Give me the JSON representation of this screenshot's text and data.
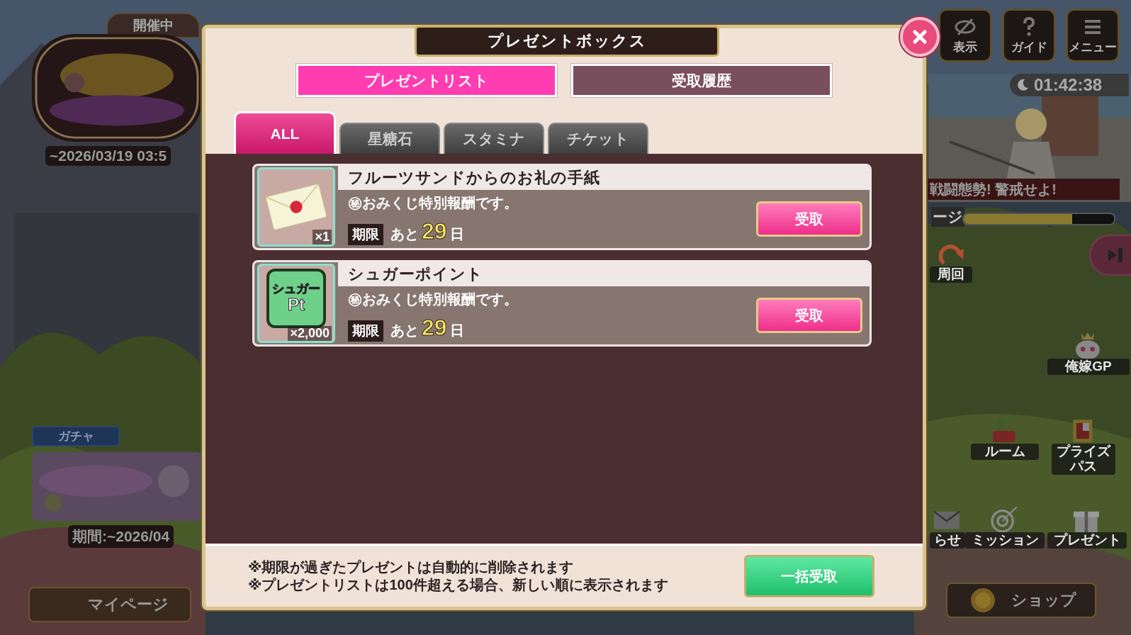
{
  "hud": {
    "event_tag": "開催中",
    "event_date": "~2026/03/19 03:5",
    "gacha_tag": "ガチャ",
    "gacha_period": "期間:~2026/04",
    "mypage_button": "マイページ",
    "top_buttons": [
      {
        "label": "表示",
        "kind": "eye"
      },
      {
        "label": "ガイド",
        "kind": "guide"
      },
      {
        "label": "メニュー",
        "kind": "menu"
      }
    ],
    "timer": "01:42:38",
    "alert": "戦闘態勢! 警戒せよ!",
    "gauge_label": "ージ",
    "gauge": {
      "level": 0.72
    },
    "side_buttons": [
      {
        "label": "周回",
        "kind": "loop"
      },
      {
        "label": "俺嫁GP",
        "kind": "crown"
      },
      {
        "label": "ルーム",
        "kind": "sofa"
      },
      {
        "label": "プライズパス",
        "kind": "frame"
      },
      {
        "label": "らせ",
        "kind": "mail"
      },
      {
        "label": "ミッション",
        "kind": "target"
      },
      {
        "label": "プレゼント",
        "kind": "gift"
      }
    ],
    "shop_button": "ショップ"
  },
  "dialog": {
    "title": "プレゼントボックス",
    "tabs": [
      {
        "label": "プレゼントリスト",
        "selected": true
      },
      {
        "label": "受取履歴",
        "selected": false
      }
    ],
    "categories": [
      {
        "label": "ALL",
        "selected": true
      },
      {
        "label": "星糖石",
        "selected": false
      },
      {
        "label": "スタミナ",
        "selected": false
      },
      {
        "label": "チケット",
        "selected": false
      }
    ],
    "items": [
      {
        "name": "フルーツサンドからのお礼の手紙",
        "icon": {
          "kind": "letter"
        },
        "quantity": "×1",
        "description": "㊙おみくじ特別報酬です。",
        "deadline_label": "期限",
        "remaining_prefix": "あと",
        "days": "29",
        "days_unit": "日",
        "button": "受取"
      },
      {
        "name": "シュガーポイント",
        "icon": {
          "kind": "points",
          "lines": [
            "シュガー",
            "Pt"
          ]
        },
        "quantity": "×2,000",
        "description": "㊙おみくじ特別報酬です。",
        "deadline_label": "期限",
        "remaining_prefix": "あと",
        "days": "29",
        "days_unit": "日",
        "button": "受取"
      }
    ],
    "notes": [
      "※期限が過ぎたプレゼントは自動的に削除されます",
      "※プレゼントリストは100件超える場合、新しい順に表示されます"
    ],
    "claim_all_button": "一括受取"
  }
}
